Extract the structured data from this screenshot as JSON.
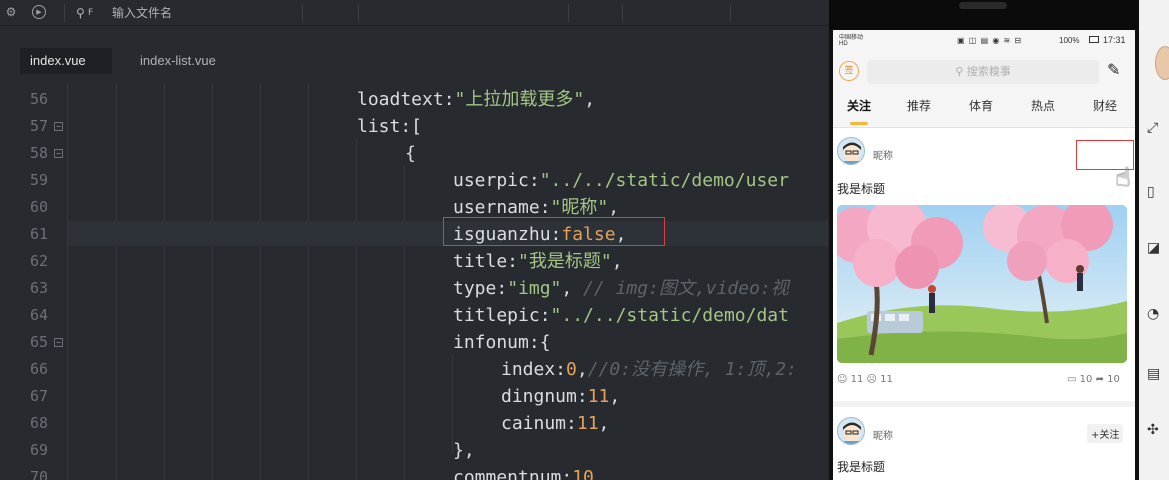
{
  "toolbar": {
    "search_placeholder": "输入文件名"
  },
  "tabs": [
    {
      "label": "index.vue"
    },
    {
      "label": "index-list.vue"
    }
  ],
  "editor": {
    "lines": [
      {
        "num": "56"
      },
      {
        "num": "57"
      },
      {
        "num": "58"
      },
      {
        "num": "59"
      },
      {
        "num": "60"
      },
      {
        "num": "61"
      },
      {
        "num": "62"
      },
      {
        "num": "63"
      },
      {
        "num": "64"
      },
      {
        "num": "65"
      },
      {
        "num": "66"
      },
      {
        "num": "67"
      },
      {
        "num": "68"
      },
      {
        "num": "69"
      },
      {
        "num": "70"
      }
    ],
    "code": {
      "l56_key": "loadtext:",
      "l56_val": "\"上拉加载更多\"",
      "l56_end": ",",
      "l57": "list:[",
      "l58": "{",
      "l59_key": "userpic:",
      "l59_val": "\"../../static/demo/user",
      "l60_key": "username:",
      "l60_val": "\"昵称\"",
      "l60_end": ",",
      "l61_key": "isguanzhu:",
      "l61_val": "false",
      "l61_end": ",",
      "l62_key": "title:",
      "l62_val": "\"我是标题\"",
      "l62_end": ",",
      "l63_key": "type:",
      "l63_val": "\"img\"",
      "l63_end": ", ",
      "l63_comment": "// img:图文,video:视",
      "l64_key": "titlepic:",
      "l64_val": "\"../../static/demo/dat",
      "l65": "infonum:{",
      "l66_key": "index:",
      "l66_val": "0",
      "l66_end": ",",
      "l66_comment": "//0:没有操作, 1:顶,2:",
      "l67_key": "dingnum:",
      "l67_val": "11",
      "l67_end": ",",
      "l68_key": "cainum:",
      "l68_val": "11",
      "l68_end": ",",
      "l69": "},",
      "l70_key": "commentnum:",
      "l70_val": "10"
    }
  },
  "phone": {
    "status": {
      "carrier": "中国移动 HD",
      "right": "100%",
      "time": "17:31"
    },
    "search_placeholder": "搜索糗事",
    "tabs": [
      "关注",
      "推荐",
      "体育",
      "热点",
      "财经"
    ],
    "posts": [
      {
        "username": "昵称",
        "title": "我是标题",
        "ding": "11",
        "cai": "11",
        "comments": "10",
        "shares": "10"
      },
      {
        "username": "昵称",
        "title": "我是标题",
        "follow_label": "+关注"
      }
    ]
  },
  "colors": {
    "accent": "#f9b73a",
    "highlight_box": "#e03a3a",
    "string": "#a3c585",
    "number": "#e4a259"
  }
}
